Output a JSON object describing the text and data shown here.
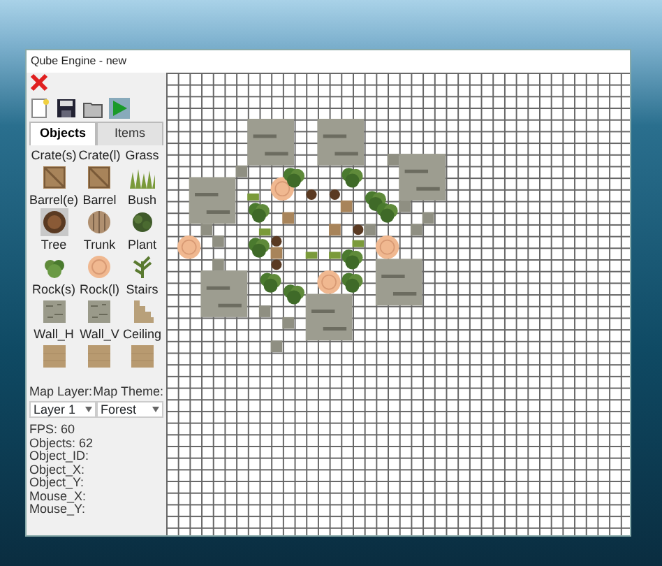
{
  "window": {
    "title": "Qube Engine - new"
  },
  "tabs": [
    {
      "label": "Objects",
      "selected": true
    },
    {
      "label": "Items",
      "selected": false
    }
  ],
  "objects": [
    {
      "label": "Crate(s)",
      "kind": "crate",
      "selected": false
    },
    {
      "label": "Crate(l)",
      "kind": "crate",
      "selected": false
    },
    {
      "label": "Grass",
      "kind": "grass",
      "selected": false
    },
    {
      "label": "Barrel(e)",
      "kind": "barrel-empty",
      "selected": true
    },
    {
      "label": "Barrel",
      "kind": "barrel",
      "selected": false
    },
    {
      "label": "Bush",
      "kind": "bush",
      "selected": false
    },
    {
      "label": "Tree",
      "kind": "tree",
      "selected": false
    },
    {
      "label": "Trunk",
      "kind": "trunk",
      "selected": false
    },
    {
      "label": "Plant",
      "kind": "plant",
      "selected": false
    },
    {
      "label": "Rock(s)",
      "kind": "rock",
      "selected": false
    },
    {
      "label": "Rock(l)",
      "kind": "rock",
      "selected": false
    },
    {
      "label": "Stairs",
      "kind": "stairs",
      "selected": false
    },
    {
      "label": "Wall_H",
      "kind": "wall",
      "selected": false
    },
    {
      "label": "Wall_V",
      "kind": "wall",
      "selected": false
    },
    {
      "label": "Ceiling",
      "kind": "wall",
      "selected": false
    }
  ],
  "map_layer": {
    "label": "Map Layer:",
    "value": "Layer 1"
  },
  "map_theme": {
    "label": "Map Theme:",
    "value": "Forest"
  },
  "stats": [
    "FPS: 60",
    "Objects: 62",
    "Object_ID:",
    "Object_X:",
    "Object_Y:",
    "Mouse_X:",
    "Mouse_Y:"
  ]
}
